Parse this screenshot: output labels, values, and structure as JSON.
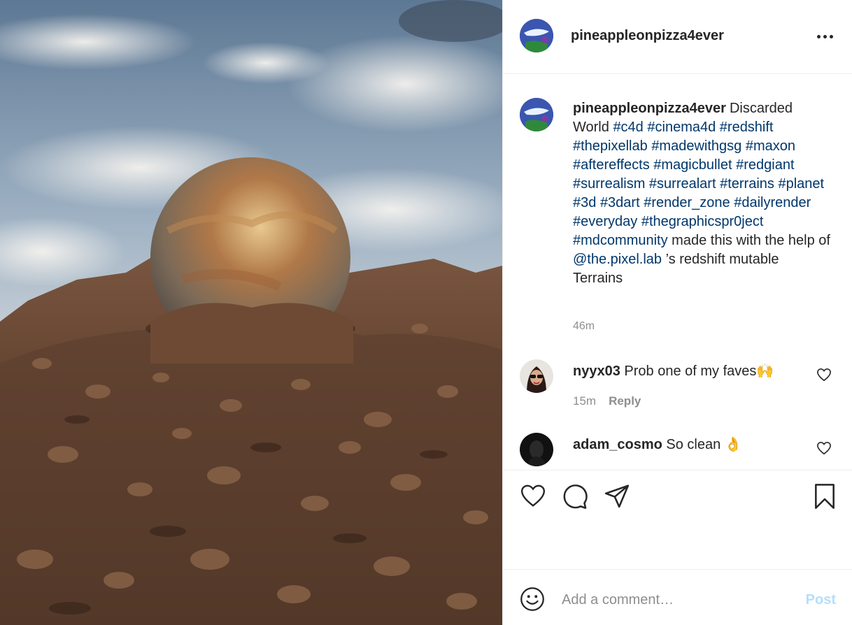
{
  "post": {
    "username": "pineappleonpizza4ever",
    "image_description_icon": "photo",
    "caption_text_1": "Discarded World",
    "hashtags": [
      "#c4d",
      "#cinema4d",
      "#redshift",
      "#thepixellab",
      "#madewithgsg",
      "#maxon",
      "#aftereffects",
      "#magicbullet",
      "#redgiant",
      "#surrealism",
      "#surrealart",
      "#terrains",
      "#planet",
      "#3d",
      "#3dart",
      "#render_zone",
      "#dailyrender",
      "#everyday",
      "#thegraphicspr0ject",
      "#mdcommunity"
    ],
    "caption_text_2": "made this with the help of",
    "mention": "@the.pixel.lab",
    "caption_text_3": "’s redshift mutable Terrains",
    "time": "46m"
  },
  "comments": [
    {
      "username": "nyyx03",
      "text": "Prob one of my faves🙌",
      "time": "15m",
      "reply": "Reply"
    },
    {
      "username": "adam_cosmo",
      "text": "So clean 👌"
    }
  ],
  "add_comment": {
    "placeholder": "Add a comment…",
    "post_label": "Post",
    "post_color": "#b2dffc"
  },
  "icons": {
    "more": "more-icon",
    "like": "heart-icon",
    "comment": "comment-icon",
    "share": "paper-plane-icon",
    "save": "bookmark-icon",
    "emoji": "emoji-icon"
  }
}
